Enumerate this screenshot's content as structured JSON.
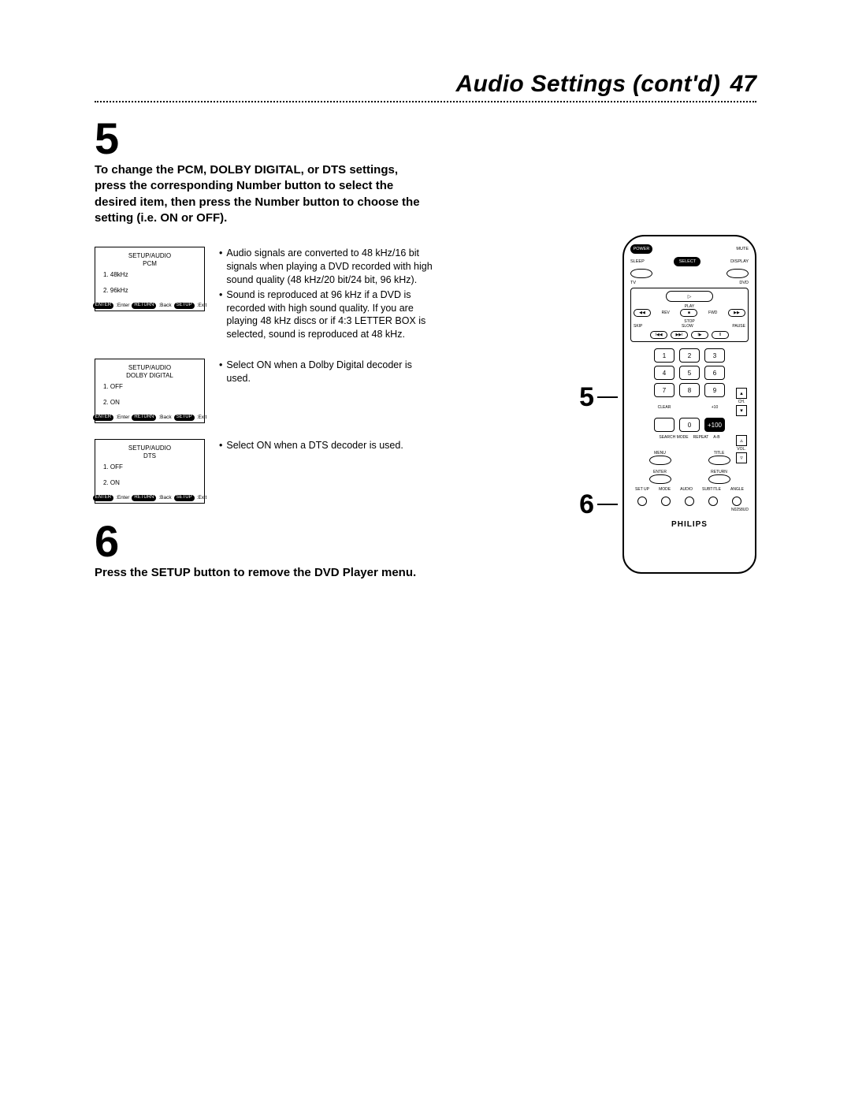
{
  "header": {
    "title": "Audio Settings (cont'd)",
    "page": "47"
  },
  "step5": {
    "number": "5",
    "text": "To change the PCM, DOLBY DIGITAL, or DTS settings, press the corresponding Number button to select the desired item, then press the Number button to choose the setting (i.e. ON or OFF)."
  },
  "step6": {
    "number": "6",
    "text": "Press the SETUP button to remove the DVD Player menu."
  },
  "osd": {
    "pcm": {
      "title": "SETUP/AUDIO",
      "sub": "PCM",
      "opt1": "1. 48kHz",
      "opt2": "2. 96kHz"
    },
    "dolby": {
      "title": "SETUP/AUDIO",
      "sub": "DOLBY DIGITAL",
      "opt1": "1. OFF",
      "opt2": "2. ON"
    },
    "dts": {
      "title": "SETUP/AUDIO",
      "sub": "DTS",
      "opt1": "1. OFF",
      "opt2": "2. ON"
    },
    "footer": {
      "enter_pill": "ENTER",
      "enter_txt": ":Enter",
      "return_pill": "RETURN",
      "return_txt": ":Back",
      "setup_pill": "SETUP",
      "setup_txt": ":Exit"
    }
  },
  "bullets": {
    "pcm1": "Audio signals are converted to 48 kHz/16 bit signals when playing a DVD recorded with high sound quality (48 kHz/20 bit/24 bit, 96 kHz).",
    "pcm2": "Sound is reproduced at 96 kHz if a DVD is recorded with high sound quality. If you are playing 48 kHz discs or if 4:3 LETTER BOX is selected, sound is reproduced at 48 kHz.",
    "dolby": "Select ON when a Dolby Digital decoder is used.",
    "dts": "Select ON when a DTS decoder is used."
  },
  "remote": {
    "power": "POWER",
    "mute": "MUTE",
    "sleep": "SLEEP",
    "select": "SELECT",
    "display": "DISPLAY",
    "tv": "TV",
    "dvd": "DVD",
    "play": "PLAY",
    "rev": "REV",
    "fwd": "FWD",
    "stop": "STOP",
    "skip": "SKIP",
    "slow": "SLOW",
    "pause": "PAUSE",
    "clear": "CLEAR",
    "plus10": "+10",
    "plus100": "+100",
    "zero": "0",
    "search": "SEARCH MODE",
    "repeat": "REPEAT",
    "ab": "A-B",
    "ch": "CH.",
    "vol": "VOL.",
    "menu": "MENU",
    "title": "TITLE",
    "enter": "ENTER",
    "return": "RETURN",
    "setup": "SET UP",
    "mode": "MODE",
    "audio": "AUDIO",
    "subtitle": "SUBTITLE",
    "angle": "ANGLE",
    "model": "N0258UD",
    "brand": "PHILIPS",
    "n1": "1",
    "n2": "2",
    "n3": "3",
    "n4": "4",
    "n5": "5",
    "n6": "6",
    "n7": "7",
    "n8": "8",
    "n9": "9"
  },
  "callouts": {
    "five": "5",
    "six": "6"
  }
}
